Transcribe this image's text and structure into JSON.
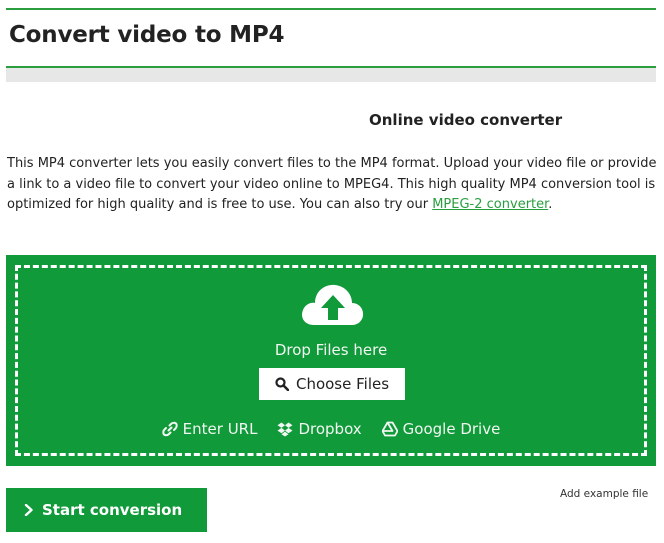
{
  "header": {
    "title": "Convert video to MP4"
  },
  "subtitle": "Online video converter",
  "description": {
    "text_before_link": "This MP4 converter lets you easily convert files to the MP4 format. Upload your video file or provide a link to a video file to convert your video online to MPEG4. This high quality MP4 conversion tool is optimized for high quality and is free to use. You can also try our ",
    "link_text": "MPEG-2 converter",
    "text_after_link": "."
  },
  "upload": {
    "drop_text": "Drop Files here",
    "choose_label": "Choose Files",
    "sources": {
      "url": "Enter URL",
      "dropbox": "Dropbox",
      "drive": "Google Drive"
    }
  },
  "actions": {
    "start_label": "Start conversion",
    "add_example": "Add example file"
  },
  "colors": {
    "accent": "#119a3a",
    "link": "#2a9d3e"
  }
}
